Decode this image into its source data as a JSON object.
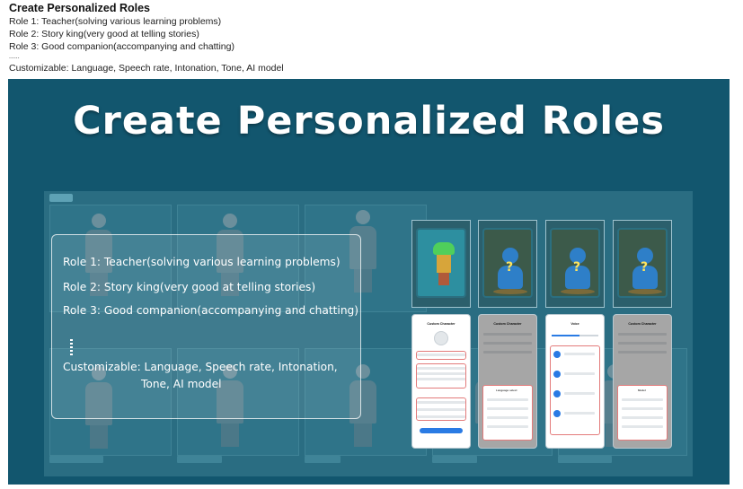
{
  "header": {
    "title": "Create Personalized Roles",
    "lines": [
      "Role 1: Teacher(solving various learning problems)",
      "Role 2: Story king(very good at telling stories)",
      "Role 3: Good companion(accompanying and chatting)",
      "......",
      "Customizable: Language, Speech rate, Intonation, Tone, AI model"
    ]
  },
  "banner": {
    "title": "Create Personalized Roles",
    "background_color": "#12566e",
    "info_box": {
      "role1": "Role 1: Teacher(solving various learning problems)",
      "role2": "Role 2: Story king(very good at telling stories)",
      "role3": "Role 3: Good companion(accompanying and chatting)",
      "customizable_line1": "Customizable: Language, Speech rate, Intonation,",
      "customizable_line2": "Tone, AI model"
    },
    "thumbnails": [
      {
        "icon": "green-hair-character-icon"
      },
      {
        "icon": "mystery-avatar-icon",
        "symbol": "?"
      },
      {
        "icon": "mystery-avatar-icon",
        "symbol": "?"
      },
      {
        "icon": "mystery-avatar-icon",
        "symbol": "?"
      }
    ],
    "phones": [
      {
        "title": "Custom Character"
      },
      {
        "title": "Custom Character",
        "sheet_title": "Language select"
      },
      {
        "title": "Voice"
      },
      {
        "title": "Custom Character",
        "sheet_title": "Model"
      }
    ]
  }
}
